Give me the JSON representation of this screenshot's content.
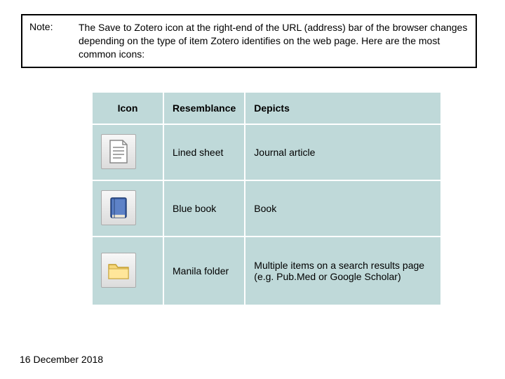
{
  "note": {
    "label": "Note:",
    "text": "The Save to Zotero icon at the right-end of the URL (address) bar of the browser changes depending on the type of item Zotero identifies on the web page. Here are the most common icons:"
  },
  "table": {
    "headers": {
      "icon": "Icon",
      "resemblance": "Resemblance",
      "depicts": "Depicts"
    },
    "rows": [
      {
        "icon": "lined-sheet-icon",
        "resemblance": "Lined sheet",
        "depicts": "Journal article"
      },
      {
        "icon": "blue-book-icon",
        "resemblance": "Blue book",
        "depicts": "Book"
      },
      {
        "icon": "manila-folder-icon",
        "resemblance": "Manila folder",
        "depicts": "Multiple items on a search results page (e.g. Pub.Med or Google Scholar)"
      }
    ]
  },
  "footer": {
    "date": "16 December 2018"
  }
}
